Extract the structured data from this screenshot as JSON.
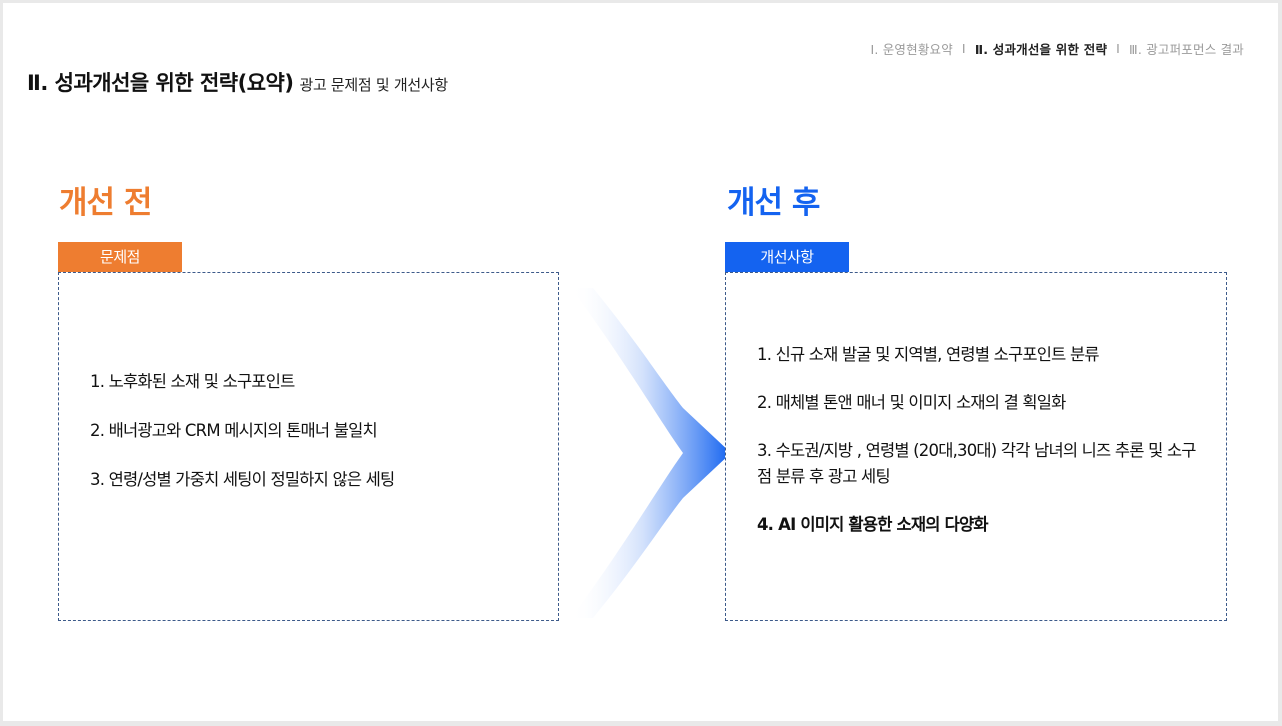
{
  "breadcrumb": {
    "items": [
      {
        "label": "Ⅰ. 운영현황요약",
        "active": false
      },
      {
        "label": "Ⅱ. 성과개선을 위한 전략",
        "active": true
      },
      {
        "label": "Ⅲ. 광고퍼포먼스 결과",
        "active": false
      }
    ],
    "separator": "I"
  },
  "title": {
    "main": "Ⅱ. 성과개선을 위한 전략(요약)",
    "sub": "광고 문제점 및 개선사항"
  },
  "before": {
    "heading": "개선 전",
    "tag": "문제점",
    "items": [
      "1.  노후화된 소재 및 소구포인트",
      "2. 배너광고와 CRM 메시지의 톤매너 불일치",
      "3. 연령/성별 가중치 세팅이 정밀하지  않은 세팅"
    ]
  },
  "after": {
    "heading": "개선 후",
    "tag": "개선사항",
    "items": [
      "1. 신규 소재 발굴 및 지역별, 연령별 소구포인트 분류",
      "2. 매체별 톤앤 매너 및 이미지 소재의 결 획일화",
      "3. 수도권/지방 , 연령별 (20대,30대) 각각 남녀의 니즈 추론 및 소구점 분류 후 광고 세팅",
      "4. AI 이미지 활용한 소재의 다양화"
    ]
  },
  "colors": {
    "before_accent": "#ee7d30",
    "after_accent": "#1463f0",
    "box_border": "#3d5a8a"
  },
  "icons": {
    "transition_arrow": "chevron-arrow-right-icon"
  }
}
